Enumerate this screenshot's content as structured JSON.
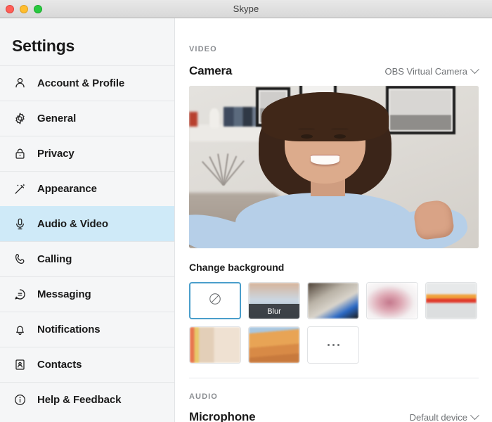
{
  "window": {
    "title": "Skype",
    "controls": {
      "close": "close-button",
      "minimize": "minimize-button",
      "maximize": "maximize-button"
    }
  },
  "sidebar": {
    "title": "Settings",
    "items": [
      {
        "label": "Account & Profile",
        "icon": "person-icon",
        "selected": false
      },
      {
        "label": "General",
        "icon": "gear-icon",
        "selected": false
      },
      {
        "label": "Privacy",
        "icon": "lock-icon",
        "selected": false
      },
      {
        "label": "Appearance",
        "icon": "magic-wand-icon",
        "selected": false
      },
      {
        "label": "Audio & Video",
        "icon": "microphone-icon",
        "selected": true
      },
      {
        "label": "Calling",
        "icon": "phone-icon",
        "selected": false
      },
      {
        "label": "Messaging",
        "icon": "chat-bubble-icon",
        "selected": false
      },
      {
        "label": "Notifications",
        "icon": "bell-icon",
        "selected": false
      },
      {
        "label": "Contacts",
        "icon": "contact-card-icon",
        "selected": false
      },
      {
        "label": "Help & Feedback",
        "icon": "info-circle-icon",
        "selected": false
      }
    ]
  },
  "main": {
    "video_section": {
      "label": "VIDEO",
      "camera": {
        "title": "Camera",
        "selected_device": "OBS Virtual Camera",
        "chevron": "chevron-down-icon"
      },
      "preview_alt": "camera-preview",
      "change_background": {
        "title": "Change background",
        "options": [
          {
            "name": "none",
            "label": "",
            "selected": true,
            "style": "none"
          },
          {
            "name": "blur",
            "label": "Blur",
            "selected": false,
            "style": "th-blur"
          },
          {
            "name": "bike",
            "label": "",
            "selected": false,
            "style": "th-bike"
          },
          {
            "name": "pink",
            "label": "",
            "selected": false,
            "style": "th-pink"
          },
          {
            "name": "fish",
            "label": "",
            "selected": false,
            "style": "th-fish"
          },
          {
            "name": "room",
            "label": "",
            "selected": false,
            "style": "th-room"
          },
          {
            "name": "dune",
            "label": "",
            "selected": false,
            "style": "th-dune"
          },
          {
            "name": "more",
            "label": "...",
            "selected": false,
            "style": "more"
          }
        ]
      }
    },
    "audio_section": {
      "label": "AUDIO",
      "microphone": {
        "title": "Microphone",
        "selected_device": "Default device",
        "chevron": "chevron-down-icon"
      }
    }
  },
  "colors": {
    "selected_nav_bg": "#cfeaf8",
    "selected_thumb_border": "#4a9ecb",
    "sidebar_bg": "#f5f6f7",
    "text_primary": "#1a1a1a",
    "text_muted": "#8a8d91"
  }
}
